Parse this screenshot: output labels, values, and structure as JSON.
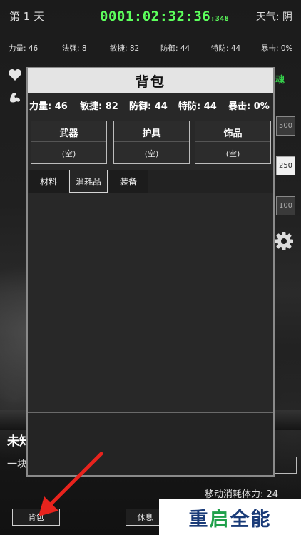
{
  "header": {
    "day": "第 1 天",
    "timer_main": "0001:02:32:36",
    "timer_ms": ":348",
    "weather": "天气: 阴"
  },
  "stats": [
    {
      "label": "力量",
      "value": "46",
      "text": "力量: 46"
    },
    {
      "label": "法强",
      "value": "8",
      "text": "法强: 8"
    },
    {
      "label": "敏捷",
      "value": "82",
      "text": "敏捷: 82"
    },
    {
      "label": "防御",
      "value": "44",
      "text": "防御: 44"
    },
    {
      "label": "特防",
      "value": "44",
      "text": "特防: 44"
    },
    {
      "label": "暴击",
      "value": "0%",
      "text": "暴击: 0%"
    }
  ],
  "side": {
    "soul_label": "魂",
    "speed_options": [
      "500",
      "250",
      "100"
    ],
    "speed_selected": "250"
  },
  "inventory": {
    "title": "背包",
    "stats": [
      "力量: 46",
      "敏捷: 82",
      "防御: 44",
      "特防: 44",
      "暴击: 0%"
    ],
    "slots": [
      {
        "name": "武器",
        "value": "(空)"
      },
      {
        "name": "护具",
        "value": "(空)"
      },
      {
        "name": "饰品",
        "value": "(空)"
      }
    ],
    "tabs": [
      {
        "label": "材料",
        "active": false
      },
      {
        "label": "消耗品",
        "active": true
      },
      {
        "label": "装备",
        "active": false
      }
    ]
  },
  "area": {
    "title": "未知",
    "description": "一块",
    "move_cost": "移动消耗体力: 24"
  },
  "bottom_buttons": {
    "bag": "背包",
    "rest": "休息"
  },
  "watermark": {
    "part1": "重",
    "part2": "启",
    "part3": "全能"
  },
  "colors": {
    "timer_green": "#5cff5c",
    "soul_green": "#35d04b",
    "annotation_red": "#e8231d"
  }
}
